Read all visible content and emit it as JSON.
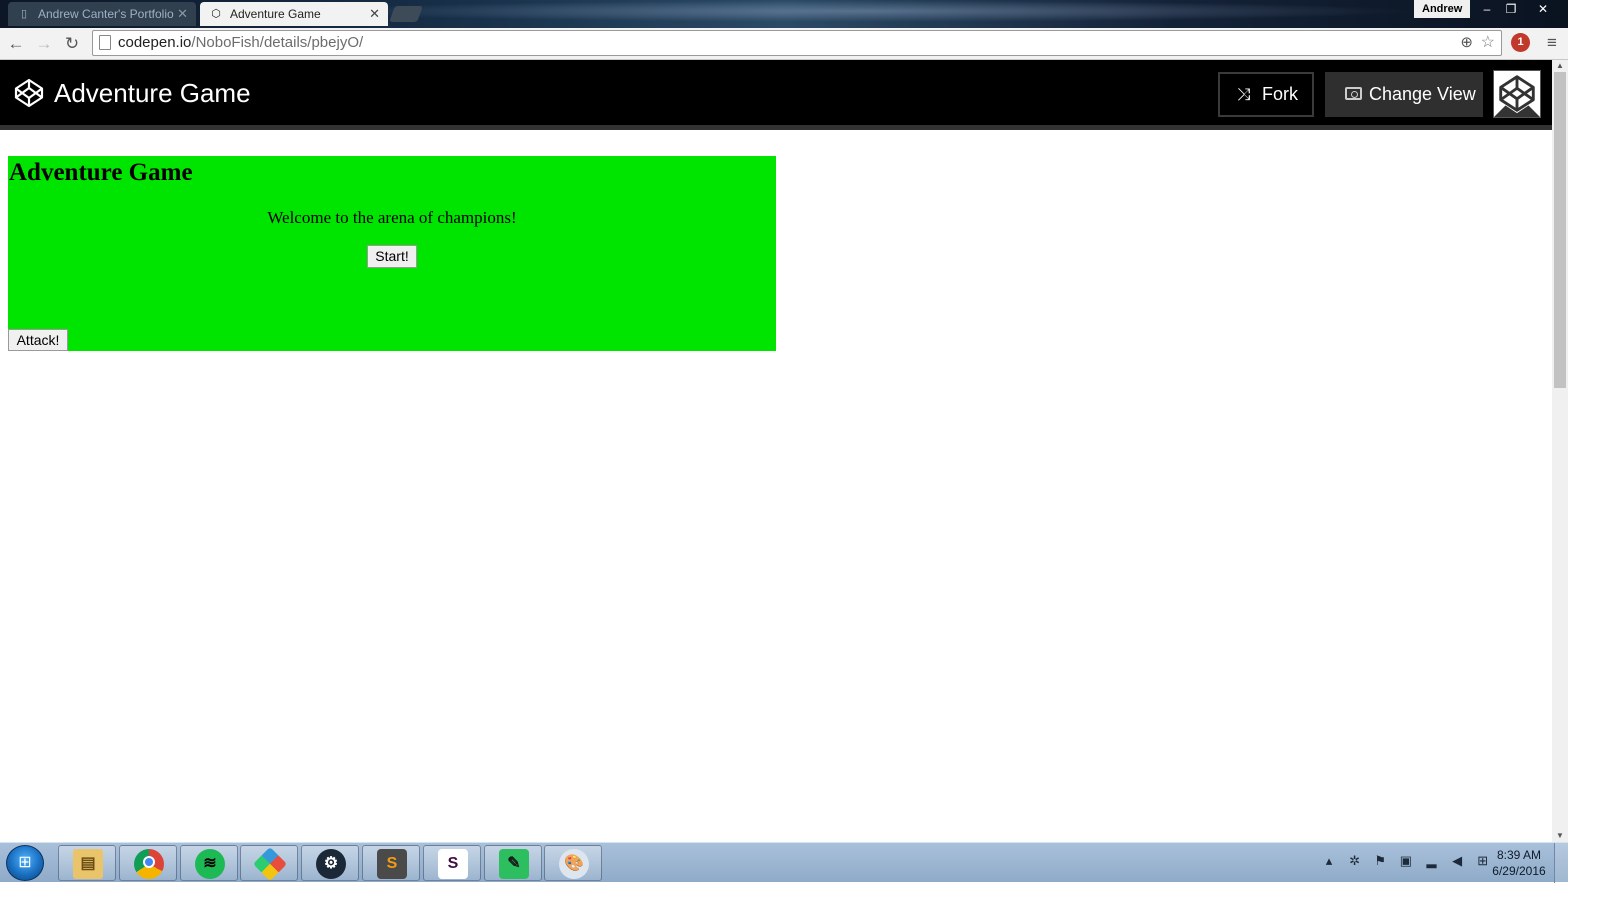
{
  "browser": {
    "tabs": [
      {
        "label": "Andrew Canter's Portfolio",
        "active": false
      },
      {
        "label": "Adventure Game",
        "active": true
      }
    ],
    "profile_name": "Andrew",
    "window_controls": {
      "minimize": "–",
      "restore": "❐",
      "close": "✕"
    },
    "url_host": "codepen.io",
    "url_path": "/NoboFish/details/pbejyO/",
    "extension_badge": "1"
  },
  "codepen": {
    "title": "Adventure Game",
    "fork_label": "Fork",
    "change_view_label": "Change View"
  },
  "game": {
    "title": "Adventure Game",
    "welcome": "Welcome to the arena of champions!",
    "start_label": "Start!",
    "attack_label": "Attack!",
    "panel_color": "#00e500"
  },
  "taskbar": {
    "apps": [
      "file-explorer",
      "chrome",
      "spotify",
      "game-launcher",
      "steam",
      "sublime-text",
      "slack",
      "evernote",
      "paint"
    ],
    "clock_time": "8:39 AM",
    "clock_date": "6/29/2016"
  }
}
